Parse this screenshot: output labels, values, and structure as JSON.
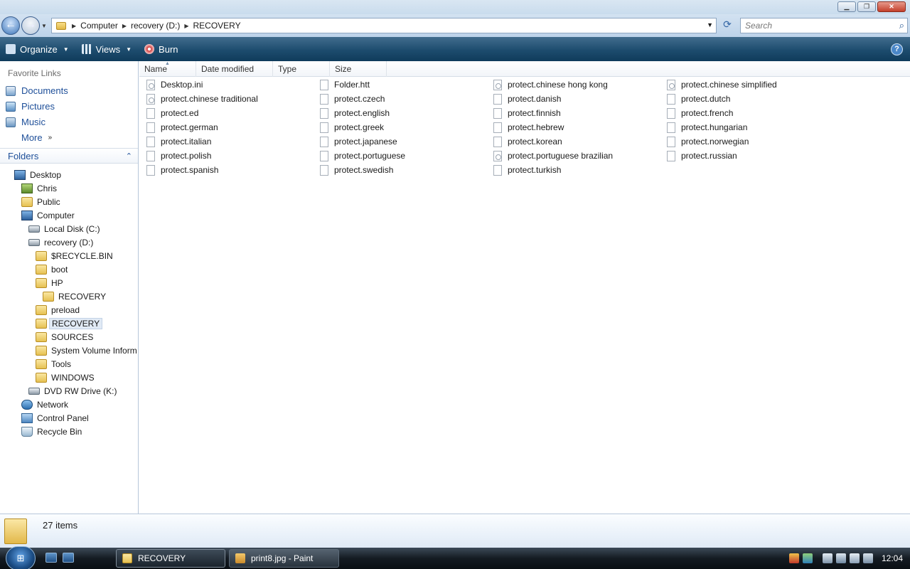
{
  "window": {
    "minimize": "▁",
    "maximize": "❐",
    "close": "✕"
  },
  "address": {
    "back_glyph": "←",
    "forward_glyph": "→",
    "segments": [
      "Computer",
      "recovery (D:)",
      "RECOVERY"
    ],
    "search_placeholder": "Search",
    "search_glyph": "⌕",
    "refresh_glyph": "⟳"
  },
  "toolbar": {
    "organize": "Organize",
    "views": "Views",
    "burn": "Burn",
    "help": "?"
  },
  "nav": {
    "favorites_header": "Favorite Links",
    "favorites": [
      "Documents",
      "Pictures",
      "Music"
    ],
    "more": "More",
    "folders_header": "Folders",
    "tree": [
      {
        "label": "Desktop",
        "icon": "desktop-icon"
      },
      {
        "label": "Chris",
        "icon": "user-icon"
      },
      {
        "label": "Public",
        "icon": "folder-icon"
      },
      {
        "label": "Computer",
        "icon": "computer-icon"
      },
      {
        "label": "Local Disk (C:)",
        "icon": "disk-icon"
      },
      {
        "label": "recovery (D:)",
        "icon": "disk-icon"
      },
      {
        "label": "$RECYCLE.BIN",
        "icon": "folder-icon"
      },
      {
        "label": "boot",
        "icon": "folder-icon"
      },
      {
        "label": "HP",
        "icon": "folder-icon"
      },
      {
        "label": "RECOVERY",
        "icon": "folder-icon"
      },
      {
        "label": "preload",
        "icon": "folder-icon"
      },
      {
        "label": "RECOVERY",
        "icon": "folder-icon"
      },
      {
        "label": "SOURCES",
        "icon": "folder-icon"
      },
      {
        "label": "System Volume Inform",
        "icon": "folder-icon"
      },
      {
        "label": "Tools",
        "icon": "folder-icon"
      },
      {
        "label": "WINDOWS",
        "icon": "folder-icon"
      },
      {
        "label": "DVD RW Drive (K:)",
        "icon": "dvd-icon"
      },
      {
        "label": "Network",
        "icon": "network-icon"
      },
      {
        "label": "Control Panel",
        "icon": "control-panel-icon"
      },
      {
        "label": "Recycle Bin",
        "icon": "recycle-bin-icon"
      }
    ]
  },
  "columns": [
    "Name",
    "Date modified",
    "Type",
    "Size"
  ],
  "files": [
    [
      "Desktop.ini",
      "Folder.htt",
      "protect.chinese hong kong",
      "protect.chinese simplified"
    ],
    [
      "protect.chinese traditional",
      "protect.czech",
      "protect.danish",
      "protect.dutch"
    ],
    [
      "protect.ed",
      "protect.english",
      "protect.finnish",
      "protect.french"
    ],
    [
      "protect.german",
      "protect.greek",
      "protect.hebrew",
      "protect.hungarian"
    ],
    [
      "protect.italian",
      "protect.japanese",
      "protect.korean",
      "protect.norwegian"
    ],
    [
      "protect.polish",
      "protect.portuguese",
      "protect.portuguese brazilian",
      "protect.russian"
    ],
    [
      "protect.spanish",
      "protect.swedish",
      "protect.turkish",
      ""
    ]
  ],
  "status": {
    "count": "27 items"
  },
  "taskbar": {
    "start_glyph": "⊞",
    "tasks": [
      "RECOVERY",
      "print8.jpg - Paint"
    ],
    "clock": "12:04"
  }
}
